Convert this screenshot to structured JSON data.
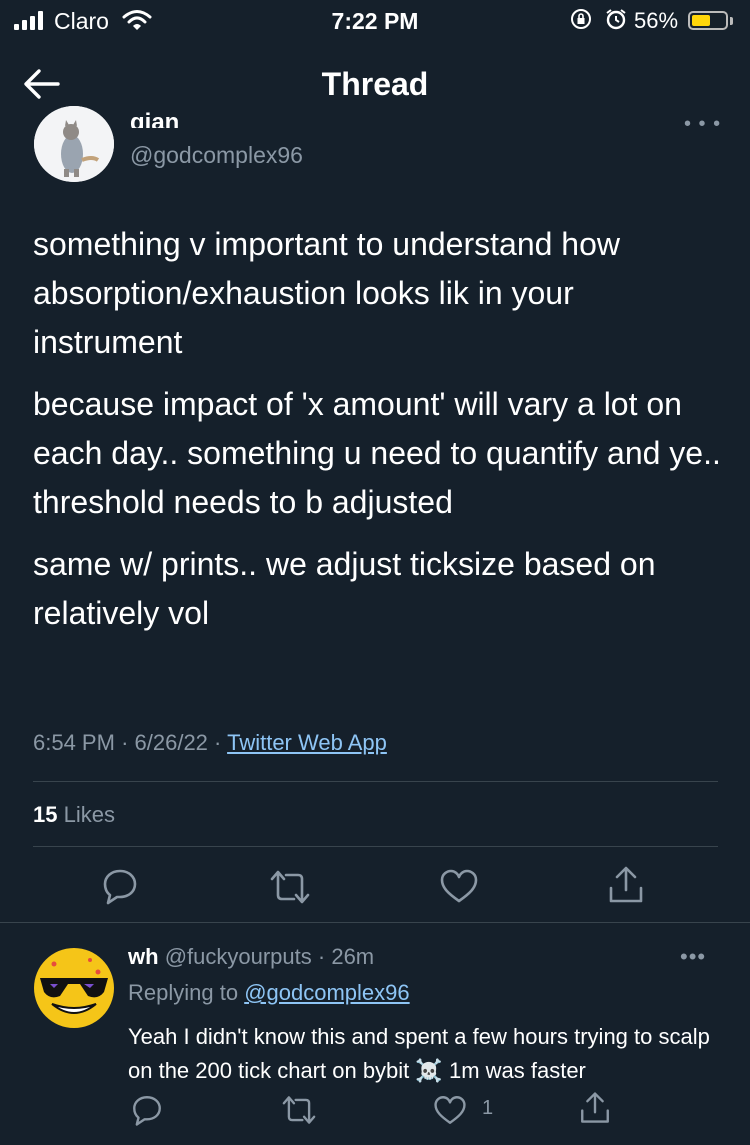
{
  "status_bar": {
    "carrier": "Claro",
    "time": "7:22 PM",
    "battery": "56%",
    "battery_level": 0.56
  },
  "header": {
    "title": "Thread"
  },
  "tweet": {
    "author_name": "gian",
    "author_handle": "@godcomplex96",
    "paragraphs": [
      "something v important to understand how absorption/exhaustion looks lik in your instrument",
      "because impact of 'x amount' will vary a lot on each day.. something u need to quantify and ye.. threshold needs to b adjusted",
      "same w/ prints.. we adjust ticksize based on relatively vol"
    ],
    "time": "6:54 PM",
    "date": "6/26/22",
    "source": "Twitter Web App",
    "likes_count": "15",
    "likes_label": "Likes"
  },
  "reply": {
    "author_name": "wh",
    "author_handle": "@fuckyourputs",
    "age": "26m",
    "replying_to_label": "Replying to",
    "replying_to_handle": "@godcomplex96",
    "text_before_emoji": "Yeah I didn't know this and spent a few hours trying to scalp on the 200 tick chart on bybit",
    "emoji": "☠️",
    "text_after_emoji": "1m was faster",
    "like_count": "1"
  },
  "colors": {
    "background": "#15202b",
    "secondary_text": "#8b98a5",
    "link": "#8ec5f5",
    "divider": "#38444d",
    "battery": "#ffd60a"
  },
  "icons": {
    "back": "arrow-left-icon",
    "reply": "reply-bubble-icon",
    "retweet": "retweet-icon",
    "like": "heart-icon",
    "share": "share-icon",
    "more": "more-dots-icon"
  }
}
